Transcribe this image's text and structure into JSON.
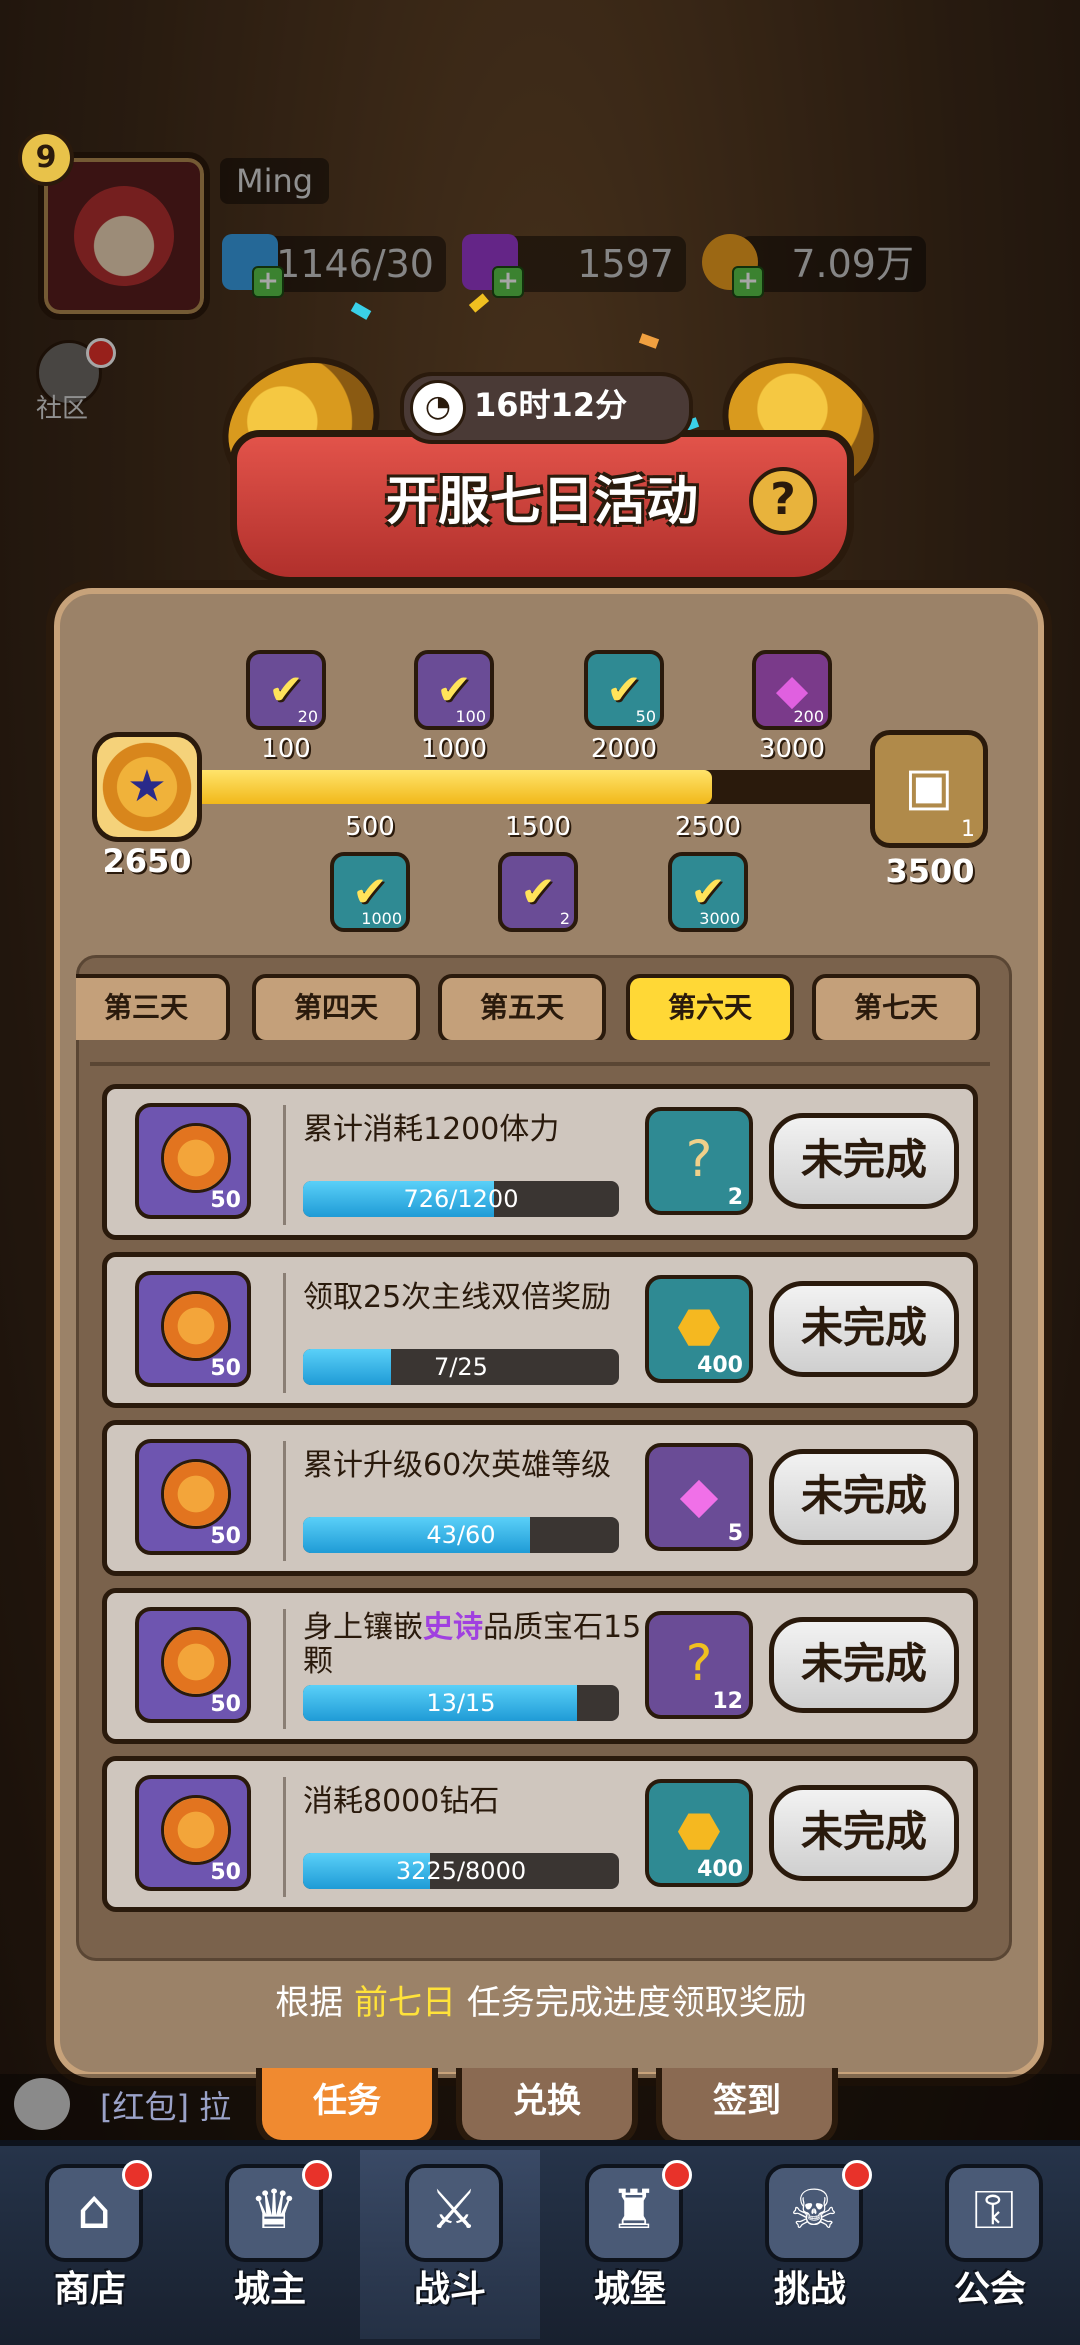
{
  "player": {
    "level": "9",
    "name": "Ming"
  },
  "resources": [
    {
      "name": "stamina",
      "icon": "lightning-icon",
      "value": "1146/30",
      "color": "#3aa0e8"
    },
    {
      "name": "diamond",
      "icon": "gem-icon",
      "value": "1597",
      "color": "#9a3ad0"
    },
    {
      "name": "gold",
      "icon": "coin-icon",
      "value": "7.09万",
      "color": "#f0a020"
    }
  ],
  "side": {
    "community_label": "社区"
  },
  "event": {
    "timer": "16时12分",
    "title": "开服七日活动",
    "help": "?",
    "progress": {
      "current": "2650",
      "current_value": 2650,
      "max": "3500",
      "max_value": 3500,
      "chest_count": "1"
    },
    "milestones_top": [
      {
        "threshold": "100",
        "count": "20",
        "style": "purple"
      },
      {
        "threshold": "1000",
        "count": "100",
        "style": "purple"
      },
      {
        "threshold": "2000",
        "count": "50",
        "style": "teal"
      },
      {
        "threshold": "3000",
        "count": "200",
        "style": "pink"
      }
    ],
    "milestones_bottom": [
      {
        "threshold": "500",
        "count": "1000",
        "style": "teal"
      },
      {
        "threshold": "1500",
        "count": "2",
        "style": "purple"
      },
      {
        "threshold": "2500",
        "count": "3000",
        "style": "teal"
      }
    ],
    "day_tabs": [
      "第三天",
      "第四天",
      "第五天",
      "第六天",
      "第七天"
    ],
    "active_day": "第六天",
    "tasks": [
      {
        "title": "累计消耗1200体力",
        "points": "50",
        "progress": "726/1200",
        "ratio": 0.605,
        "reward_count": "2",
        "reward_icon": "scroll-icon",
        "reward_color": "#2f8a93",
        "button": "未完成"
      },
      {
        "title": "领取25次主线双倍奖励",
        "points": "50",
        "progress": "7/25",
        "ratio": 0.28,
        "reward_count": "400",
        "reward_icon": "coin-icon",
        "reward_color": "#2f8a93",
        "button": "未完成"
      },
      {
        "title": "累计升级60次英雄等级",
        "points": "50",
        "progress": "43/60",
        "ratio": 0.717,
        "reward_count": "5",
        "reward_icon": "gem-icon",
        "reward_color": "#6a4c96",
        "button": "未完成"
      },
      {
        "title_parts": [
          "身上镶嵌",
          "史诗",
          "品质宝石15颗"
        ],
        "points": "50",
        "progress": "13/15",
        "ratio": 0.867,
        "reward_count": "12",
        "reward_icon": "puzzle-icon",
        "reward_color": "#6a4c96",
        "button": "未完成"
      },
      {
        "title": "消耗8000钻石",
        "points": "50",
        "progress": "3225/8000",
        "ratio": 0.403,
        "reward_count": "400",
        "reward_icon": "coin-icon",
        "reward_color": "#2f8a93",
        "button": "未完成"
      }
    ],
    "footer_parts": [
      "根据",
      "前七日",
      "任务完成进度领取奖励"
    ]
  },
  "subtabs": [
    "任务",
    "兑换",
    "签到"
  ],
  "chat": {
    "text": "[红包] 拉"
  },
  "nav": [
    {
      "label": "商店",
      "icon": "shop-icon",
      "dot": true
    },
    {
      "label": "城主",
      "icon": "crown-icon",
      "dot": true
    },
    {
      "label": "战斗",
      "icon": "swords-icon",
      "dot": false,
      "active": true
    },
    {
      "label": "城堡",
      "icon": "castle-icon",
      "dot": true
    },
    {
      "label": "挑战",
      "icon": "demon-icon",
      "dot": true
    },
    {
      "label": "公会",
      "icon": "lock-icon",
      "dot": false
    }
  ]
}
